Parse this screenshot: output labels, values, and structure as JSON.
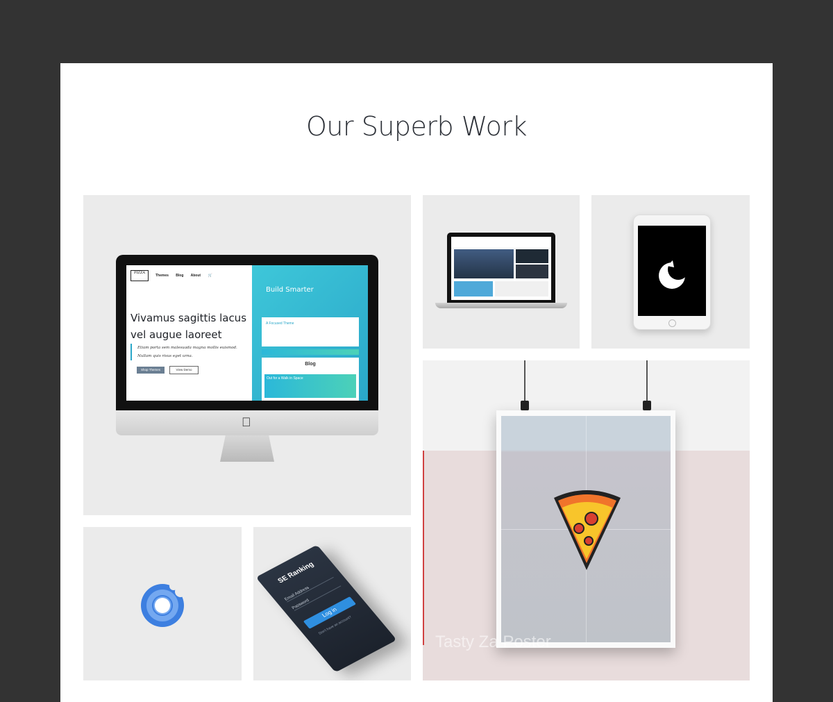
{
  "section": {
    "title": "Our Superb Work"
  },
  "colors": {
    "background": "#333333",
    "panel": "#ffffff",
    "tile": "#ebebeb",
    "accent": "#2aa7c9",
    "donut": "#3d7fe0"
  },
  "portfolio": {
    "imac": {
      "nav": [
        "Themes",
        "Blog",
        "About"
      ],
      "heading": "Vivamus sagittis lacus vel augue laoreet",
      "quote": "Etiam porta sem malesuada magna mollis euismod. Nullam quis risus eget urna.",
      "primary_button": "Shop Themes",
      "secondary_button": "View Demo",
      "side_title": "Build Smarter",
      "side_card_title": "A Focused Theme",
      "side_blog": "Blog",
      "side_post": "Out for a Walk in Space"
    },
    "phone": {
      "title": "SE Ranking",
      "email": "Email Address",
      "password": "Password",
      "login": "Log in",
      "link": "Don't have an account?"
    },
    "poster": {
      "caption": "Tasty Za Poster"
    }
  }
}
